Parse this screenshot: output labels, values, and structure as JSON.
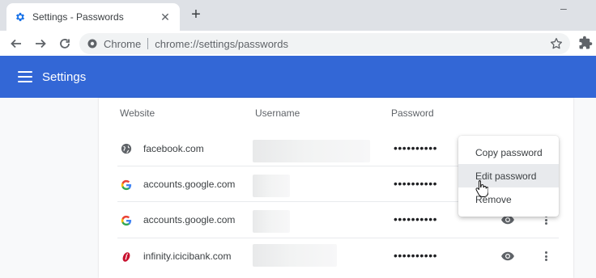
{
  "browser": {
    "tab": {
      "title": "Settings - Passwords",
      "icon": "gear-icon",
      "close": "✕"
    },
    "new_tab": "+",
    "window_min": "–",
    "omnibox": {
      "chip_label": "Chrome",
      "url_prefix": "chrome://",
      "url_path": "settings/passwords"
    }
  },
  "header": {
    "title": "Settings",
    "color": "#3367d6"
  },
  "table": {
    "columns": [
      "Website",
      "Username",
      "Password"
    ],
    "rows": [
      {
        "site": "facebook.com",
        "icon": "globe-icon",
        "password": "••••••••••"
      },
      {
        "site": "accounts.google.com",
        "icon": "google-icon",
        "password": "••••••••••"
      },
      {
        "site": "accounts.google.com",
        "icon": "google-icon",
        "password": "••••••••••"
      },
      {
        "site": "infinity.icicibank.com",
        "icon": "icici-icon",
        "password": "••••••••••"
      }
    ]
  },
  "context_menu": {
    "items": [
      "Copy password",
      "Edit password",
      "Remove"
    ],
    "hovered": "Edit password"
  }
}
